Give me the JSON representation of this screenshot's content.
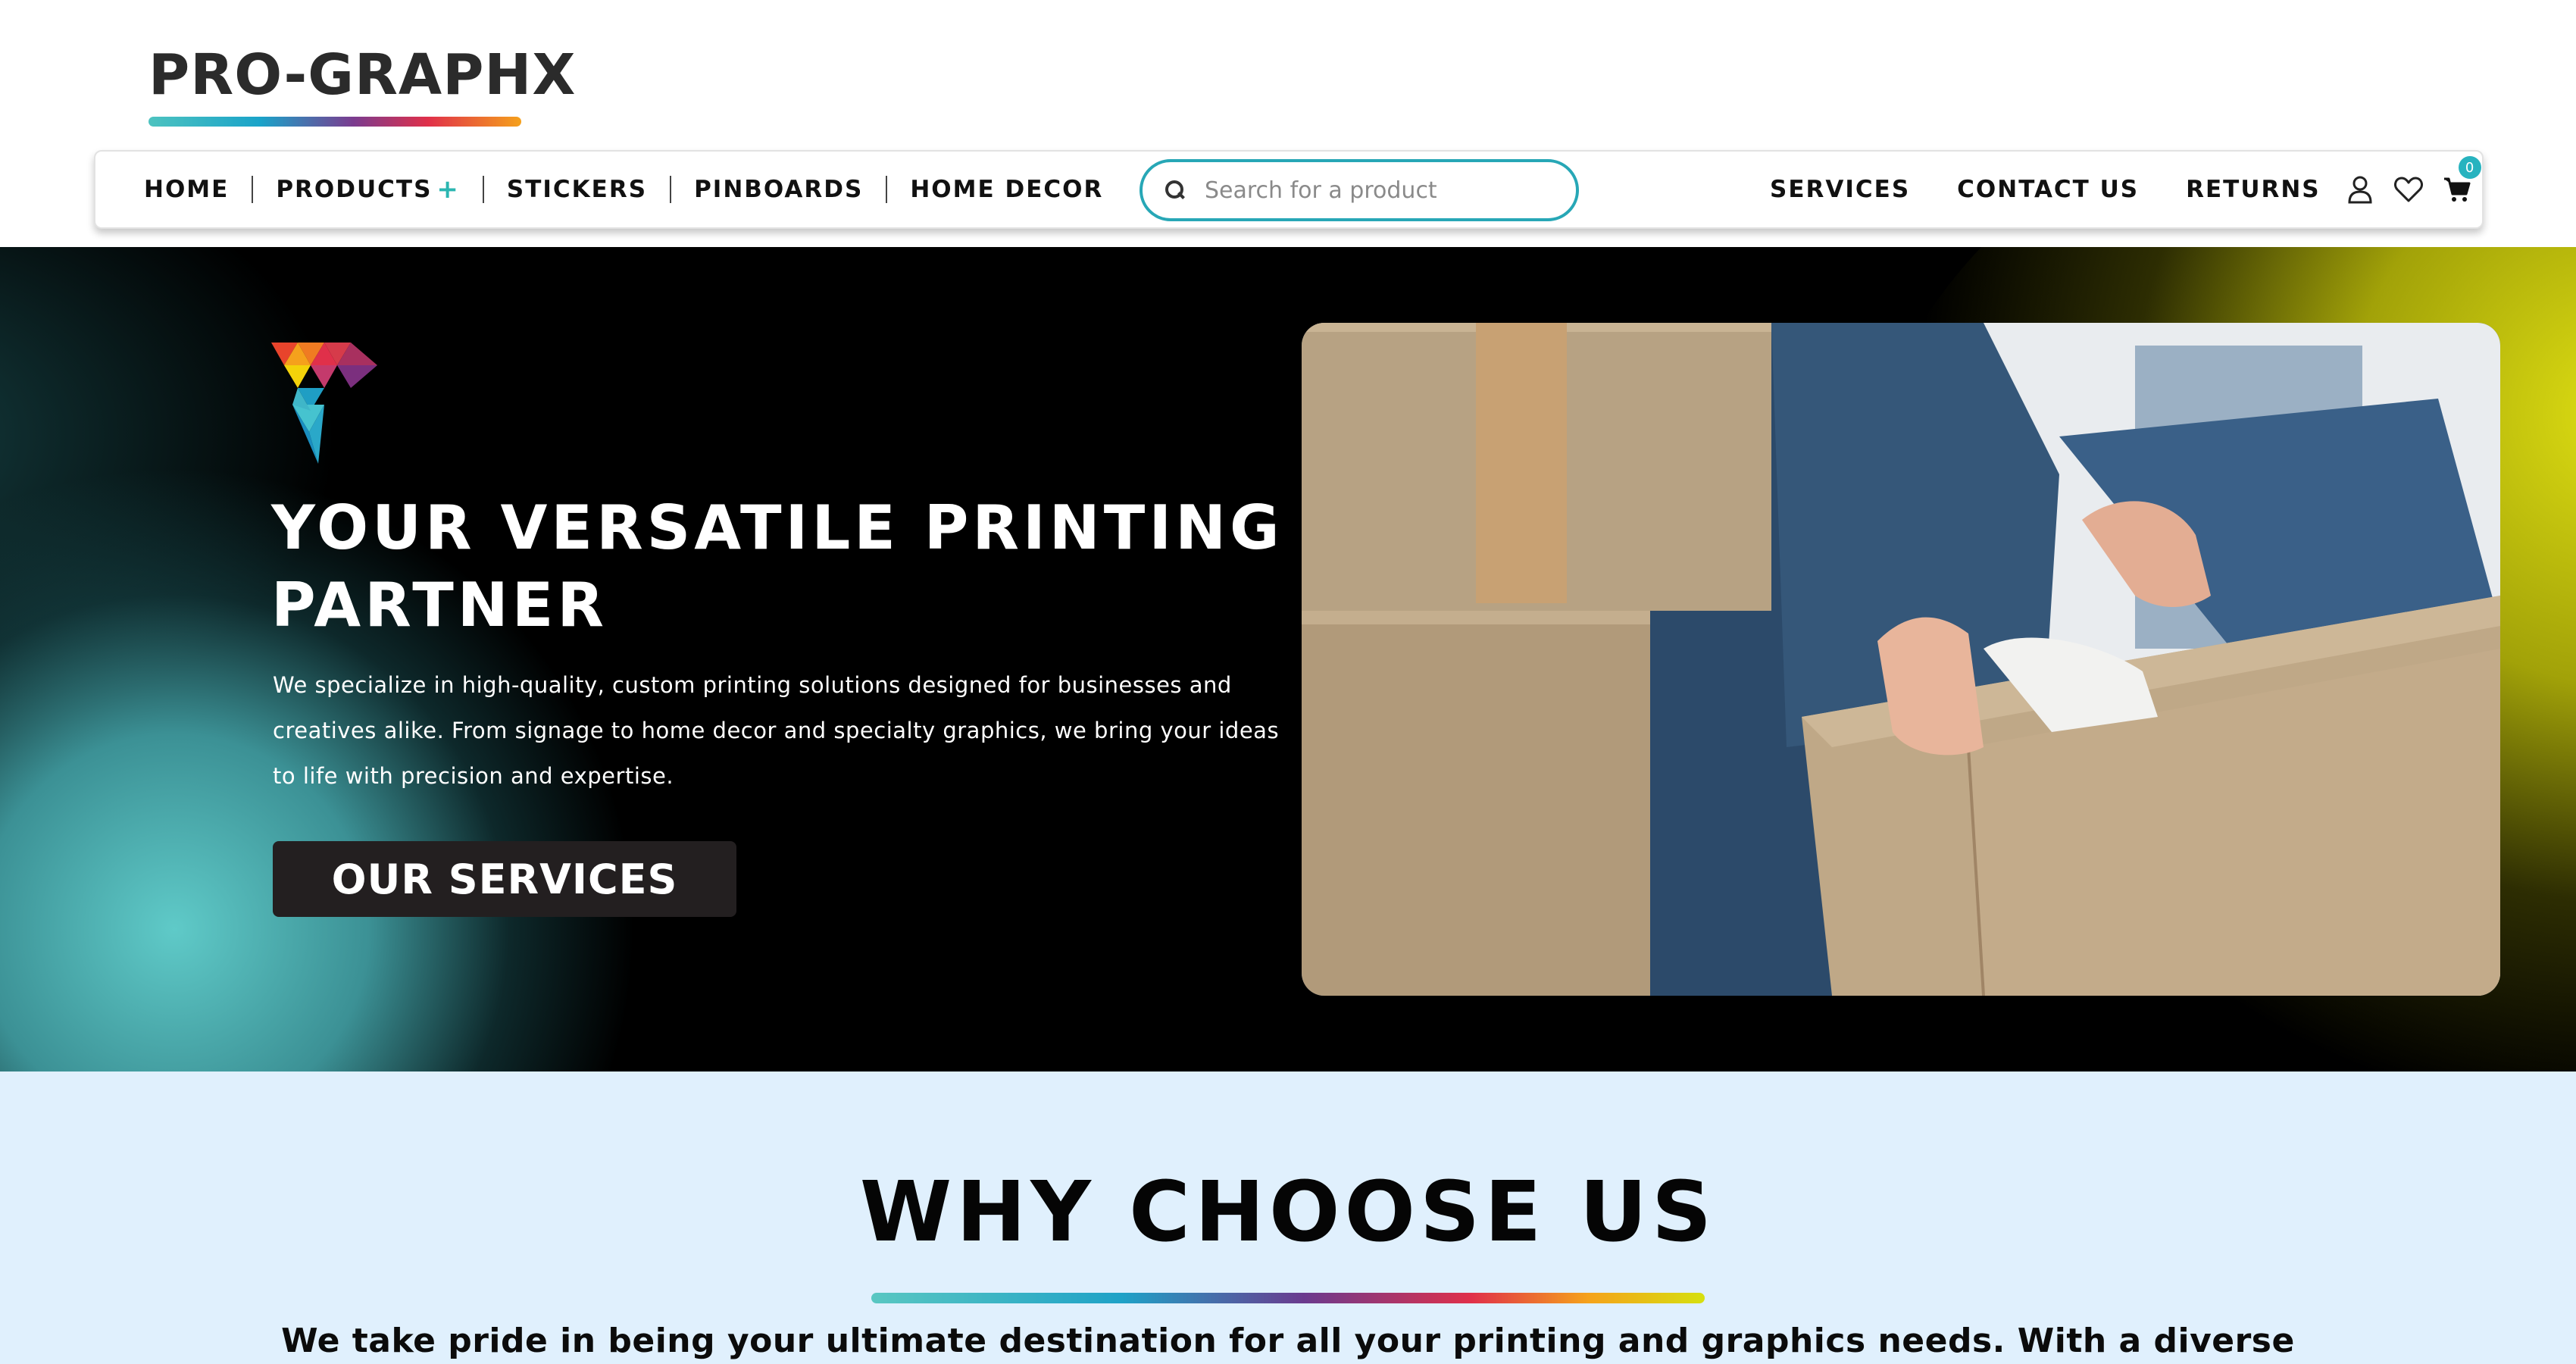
{
  "brand": {
    "logo_text": "PRO-GRAPHX"
  },
  "nav": {
    "left_items": [
      {
        "label": "HOME"
      },
      {
        "label": "PRODUCTS",
        "suffix": "+"
      },
      {
        "label": "STICKERS"
      },
      {
        "label": "PINBOARDS"
      },
      {
        "label": "HOME DECOR"
      }
    ],
    "search_placeholder": "Search for a product",
    "right_items": [
      {
        "label": "SERVICES"
      },
      {
        "label": "CONTACT US"
      },
      {
        "label": "RETURNS"
      }
    ],
    "cart_count": "0",
    "icons": [
      "search-icon",
      "user-icon",
      "heart-icon",
      "cart-icon"
    ]
  },
  "hero": {
    "title": "YOUR VERSATILE PRINTING PARTNER",
    "text": "We specialize in high-quality, custom printing solutions designed for businesses and creatives alike. From signage to home decor and specialty graphics, we bring your ideas to life with precision and expertise.",
    "button_label": "OUR SERVICES"
  },
  "why": {
    "title": "WHY CHOOSE US",
    "text": "We take pride in being your ultimate destination for all your printing and graphics needs. With a diverse"
  },
  "colors": {
    "accent_teal": "#27a7b6",
    "hero_bg": "#000000",
    "why_bg": "#e0f0fd",
    "button_bg": "#231f20"
  }
}
